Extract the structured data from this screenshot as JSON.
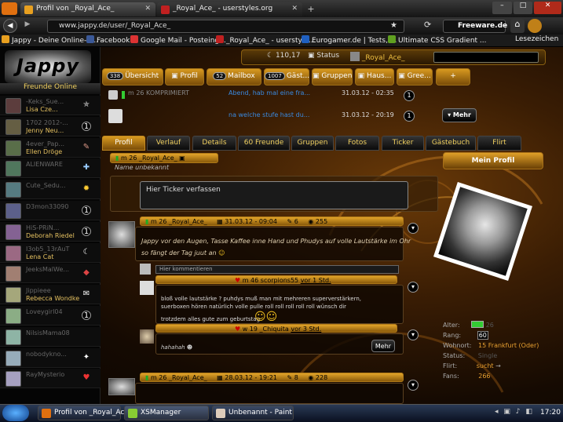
{
  "browser": {
    "tabs": [
      {
        "label": "Profil von _Royal_Ace_"
      },
      {
        "label": "_Royal_Ace_ - userstyles.org"
      }
    ],
    "url": "www.jappy.de/user/_Royal_Ace_",
    "search_label": "Freeware.de",
    "bookmarks": [
      "Jappy - Deine Online-C...",
      "Facebook",
      "Google Mail - Posteing...",
      "_Royal_Ace_ - userstyle...",
      "Eurogamer.de | Tests, ...",
      "Ultimate CSS Gradient ...",
      "Lesezeichen"
    ]
  },
  "sidebar": {
    "friends_online": "Freunde Online",
    "friends": [
      {
        "name1": "-Keks_Sue...",
        "name2": "Lisa Cze...",
        "icon": "walk-icon"
      },
      {
        "name1": "1702 2012-...",
        "name2": "Jenny Neu...",
        "icon": "counter-icon",
        "icon_text": "1"
      },
      {
        "name1": "4ever_Pap...",
        "name2": "Ellen Dröge",
        "icon": "brush-icon"
      },
      {
        "name1": "ALIENWARE",
        "name2": "",
        "icon": "wrench-icon"
      },
      {
        "name1": "Cute_Sedu...",
        "name2": "",
        "icon": "sun-icon"
      },
      {
        "name1": "D3mon33090",
        "name2": "",
        "icon": "counter-icon",
        "icon_text": "1"
      },
      {
        "name1": "HiS-PRiN...",
        "name2": "Deborah Riedel",
        "icon": "counter-icon",
        "icon_text": "1"
      },
      {
        "name1": "I3ob5_13rAuT",
        "name2": "Lena Cat",
        "icon": "moon-icon"
      },
      {
        "name1": "JeeksMalWe...",
        "name2": "",
        "icon": "pill-icon"
      },
      {
        "name1": "Jippieee",
        "name2": "Rebecca Wondke",
        "icon": "speech-icon"
      },
      {
        "name1": "Loveygirl04",
        "name2": "",
        "icon": "counter-icon",
        "icon_text": "1"
      },
      {
        "name1": "NilsisMama08",
        "name2": "",
        "icon": "none"
      },
      {
        "name1": "nobodykno...",
        "name2": "",
        "icon": "star-icon"
      },
      {
        "name1": "RayMysterio",
        "name2": "",
        "icon": "heart-icon"
      }
    ]
  },
  "topbar": {
    "points": "110,17",
    "status": "Status",
    "username": "_Royal_Ace_"
  },
  "main_tabs": [
    {
      "count": "338",
      "label": "Übersicht"
    },
    {
      "count": "",
      "label": "Profil"
    },
    {
      "count": "52",
      "label": "Mailbox"
    },
    {
      "count": "1007",
      "label": "Gäst..."
    },
    {
      "count": "",
      "label": "Gruppen"
    },
    {
      "count": "",
      "label": "Haus..."
    },
    {
      "count": "",
      "label": "Gree..."
    }
  ],
  "header_rows": [
    {
      "who": "m 26 KOMPRIMIERT",
      "msg": "Abend, hab mal eine fra...",
      "date": "31.03.12 - 02:35",
      "count": "1"
    },
    {
      "who": "",
      "msg": "na welche stufe hast du...",
      "date": "31.03.12 - 20:19",
      "count": "1"
    }
  ],
  "mehr_label": "Mehr",
  "profile_tabs": [
    "Profil",
    "Verlauf",
    "Details",
    "60 Freunde",
    "Gruppen",
    "Fotos",
    "Ticker",
    "Gästebuch",
    "Flirt"
  ],
  "profile": {
    "title": "m 26 _Royal_Ace_",
    "subtitle": "Name unbekannt",
    "mein_profil": "Mein Profil",
    "ticker_placeholder": "Hier Ticker verfassen"
  },
  "posts": [
    {
      "author": "m 26 _Royal_Ace_",
      "date": "31.03.12 - 09:04",
      "comments": "6",
      "views": "255",
      "text1": "Jappy vor den Augen, Tasse Kaffee inne Hand und Phudys auf volle Lautstärke im Ohr",
      "text2": "so fängt der Tag juut an"
    }
  ],
  "comment_placeholder": "Hier kommentieren",
  "comments": [
    {
      "author": "m 46 scorpions55",
      "ago": "vor 1 Std.",
      "line1": "bloß volle lautstärke ? puhdys muß man mit mehreren superverstärkern,",
      "line2": "suerboxen hören natürlich volle pulle roll roll roll roll roll wünsch dir",
      "line3": "trotzdem alles gute zum geburtstag"
    },
    {
      "author": "w 19 _Chiquita",
      "ago": "vor 3 Std.",
      "line1": "hahahah"
    }
  ],
  "post2": {
    "author": "m 26 _Royal_Ace_",
    "date": "28.03.12 - 19:21",
    "comments": "8",
    "views": "228"
  },
  "info": {
    "alter_label": "Alter:",
    "alter_value": "26",
    "rang_label": "Rang:",
    "rang_value": "60",
    "wohnort_label": "Wohnort:",
    "wohnort_value": "15 Frankfurt (Oder)",
    "status_label": "Status:",
    "status_value": "Single",
    "flirt_label": "Flirt:",
    "flirt_value": "sucht",
    "fans_label": "Fans:",
    "fans_value": "266"
  },
  "taskbar": {
    "tasks": [
      "Profil von _Royal_Ac...",
      "XSManager",
      "Unbenannt - Paint"
    ],
    "clock": "17:20"
  }
}
